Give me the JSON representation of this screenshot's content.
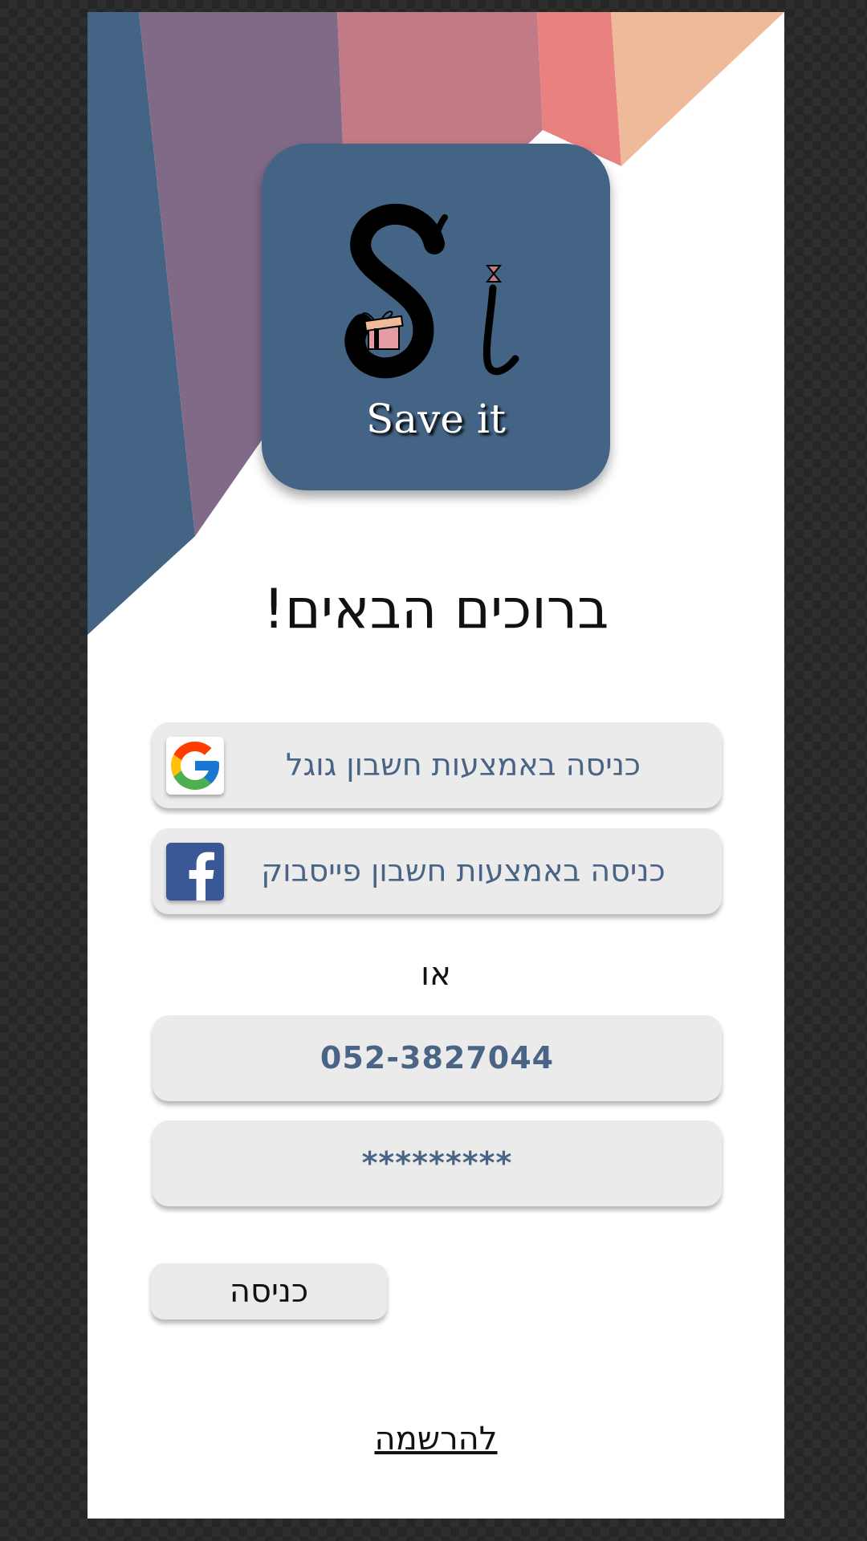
{
  "app": {
    "logo_text": "Save it",
    "welcome_title": "ברוכים הבאים!"
  },
  "social": {
    "google_label": "כניסה באמצעות חשבון גוגל",
    "facebook_label": "כניסה באמצעות חשבון פייסבוק"
  },
  "divider_text": "או",
  "form": {
    "phone_value": "052-3827044",
    "password_value": "*********",
    "login_label": "כניסה",
    "register_link": "להרשמה"
  },
  "colors": {
    "primary": "#446485",
    "field_background": "#ebebeb",
    "field_text": "#4a6485",
    "stripe_blue": "#446485",
    "stripe_purple": "#806a88",
    "stripe_rose": "#c27a86",
    "stripe_coral": "#ea8181",
    "stripe_peach": "#efba9a"
  },
  "icons": {
    "google": "google-g-logo",
    "facebook": "facebook-f-logo",
    "logo": "save-it-monogram"
  }
}
